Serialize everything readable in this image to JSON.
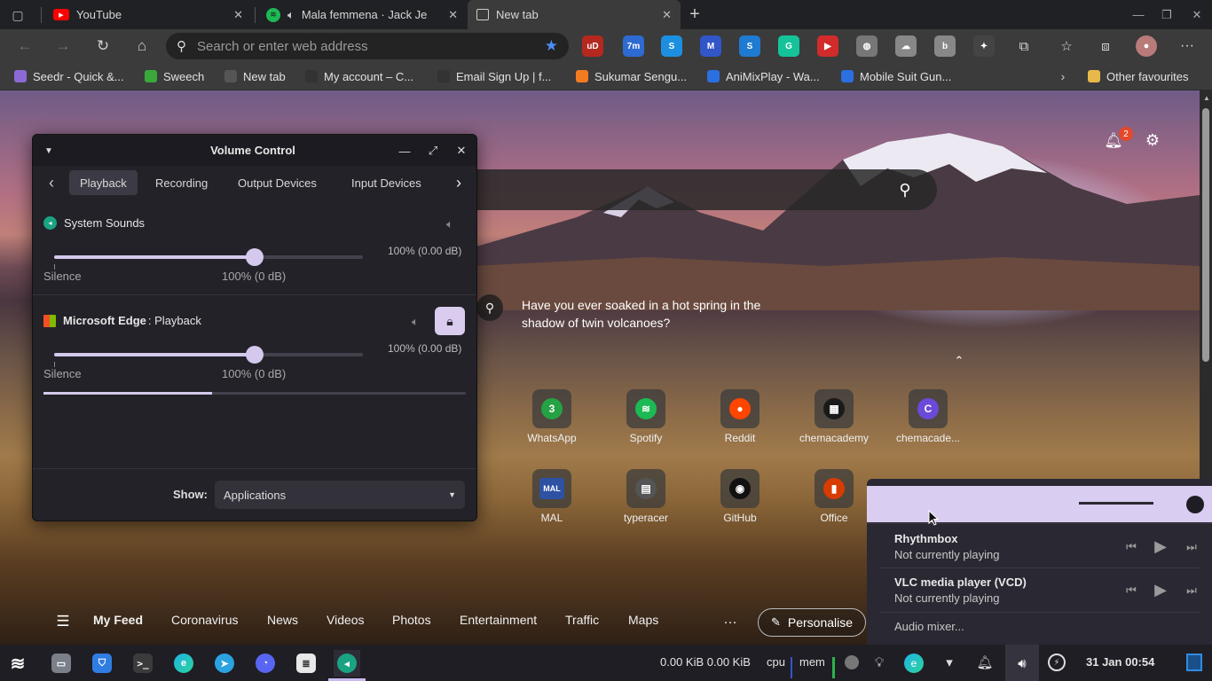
{
  "browser": {
    "tabs": [
      {
        "title": "YouTube",
        "icon": "youtube-icon"
      },
      {
        "title": "Mala femmena · Jack Je",
        "icon": "spotify-icon"
      },
      {
        "title": "New tab",
        "icon": "new-tab-icon"
      }
    ],
    "address_placeholder": "Search or enter web address",
    "extensions": [
      {
        "name": "ublock-icon",
        "label": "uD",
        "color": "#b5281f"
      },
      {
        "name": "7m-extension-icon",
        "label": "7m",
        "color": "#2d6bd3"
      },
      {
        "name": "extension-s-icon",
        "label": "S",
        "color": "#1d8fe0"
      },
      {
        "name": "extension-m-icon",
        "label": "M",
        "color": "#3056c7"
      },
      {
        "name": "extension-s2-icon",
        "label": "S",
        "color": "#1f7ad1"
      },
      {
        "name": "grammarly-icon",
        "label": "G",
        "color": "#15c39a"
      },
      {
        "name": "extension-red-icon",
        "label": "▶",
        "color": "#d22b2b"
      },
      {
        "name": "globe-icon",
        "label": "◍",
        "color": "#777"
      },
      {
        "name": "extension-cloud-icon",
        "label": "☁",
        "color": "#888"
      },
      {
        "name": "extension-b-icon",
        "label": "b",
        "color": "#888"
      },
      {
        "name": "extension-dim-icon",
        "label": "✦",
        "color": "#444"
      }
    ],
    "bookmarks": [
      {
        "label": "Seedr - Quick &...",
        "icon": "seedr-icon",
        "color": "#8c6ad6"
      },
      {
        "label": "Sweech",
        "icon": "sweech-icon",
        "color": "#3aa83a"
      },
      {
        "label": "New tab",
        "icon": "new-tab-icon",
        "color": "#555"
      },
      {
        "label": "My account – C...",
        "icon": "account-icon",
        "color": "#333"
      },
      {
        "label": "Email Sign Up | f...",
        "icon": "email-icon",
        "color": "#333"
      },
      {
        "label": "Sukumar Sengu...",
        "icon": "blogger-icon",
        "color": "#f47c20"
      },
      {
        "label": "AniMixPlay - Wa...",
        "icon": "animixplay-icon",
        "color": "#2b6fe0"
      },
      {
        "label": "Mobile Suit Gun...",
        "icon": "gundam-icon",
        "color": "#2b6fe0"
      }
    ],
    "other_favourites": "Other favourites"
  },
  "newtab": {
    "notification_count": "2",
    "fact": "Have you ever soaked in a hot spring in the shadow of twin volcanoes?",
    "tiles_row1": [
      {
        "label": "WhatsApp",
        "glyph": "3",
        "color": "#25a244"
      },
      {
        "label": "Spotify",
        "glyph": "≋",
        "color": "#1db954"
      },
      {
        "label": "Reddit",
        "glyph": "●",
        "color": "#ff4500"
      },
      {
        "label": "chemacademy",
        "glyph": "▦",
        "color": "#1a1a1a"
      },
      {
        "label": "chemacade...",
        "glyph": "C",
        "color": "#6a4ad8"
      }
    ],
    "tiles_row2": [
      {
        "label": "MAL",
        "glyph": "MAL",
        "color": "#2e51a2"
      },
      {
        "label": "typeracer",
        "glyph": "▤",
        "color": "#555"
      },
      {
        "label": "GitHub",
        "glyph": "◉",
        "color": "#111"
      },
      {
        "label": "Office",
        "glyph": "▮",
        "color": "#d83b01"
      }
    ],
    "feed": [
      "My Feed",
      "Coronavirus",
      "News",
      "Videos",
      "Photos",
      "Entertainment",
      "Traffic",
      "Maps"
    ],
    "personalise": "Personalise"
  },
  "volume_control": {
    "title": "Volume Control",
    "tabs": [
      "Playback",
      "Recording",
      "Output Devices",
      "Input Devices"
    ],
    "streams": [
      {
        "name": "System Sounds",
        "app": "",
        "value_db": "100% (0.00 dB)",
        "silence": "Silence",
        "mark": "100% (0 dB)",
        "level": 1.0
      },
      {
        "name": "Microsoft Edge",
        "app": ": Playback",
        "value_db": "100% (0.00 dB)",
        "silence": "Silence",
        "mark": "100% (0 dB)",
        "level": 1.0
      }
    ],
    "show_label": "Show:",
    "show_value": "Applications",
    "peak_meter": 0.4
  },
  "media_popup": {
    "players": [
      {
        "name": "Rhythmbox",
        "status": "Not currently playing"
      },
      {
        "name": "VLC media player (VCD)",
        "status": "Not currently playing"
      }
    ],
    "mixer": "Audio mixer..."
  },
  "taskbar": {
    "net": "0.00 KiB 0.00 KiB",
    "cpu": "cpu",
    "mem": "mem",
    "clock": "31 Jan 00:54"
  }
}
